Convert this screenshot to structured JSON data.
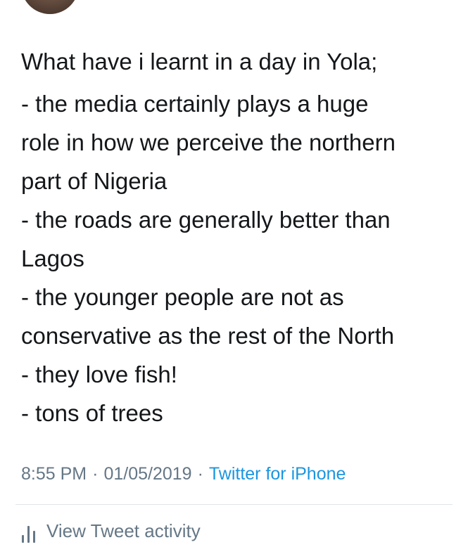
{
  "tweet": {
    "lines": [
      "What have i learnt in a day in Yola;",
      "- the media certainly plays a huge",
      "role in how we perceive the northern",
      "part of Nigeria",
      "- the roads are generally better than",
      "Lagos",
      "- the younger people are not as",
      "conservative as the rest of the North",
      "- they love fish!",
      "- tons of trees"
    ],
    "time": "8:55 PM",
    "date": "01/05/2019",
    "separator": "·",
    "source": "Twitter for iPhone"
  },
  "activity": {
    "label": "View Tweet activity",
    "icon": "bar-chart-icon"
  },
  "colors": {
    "text": "#14171a",
    "muted": "#657786",
    "link": "#1b95e0",
    "divider": "#dfe5ea"
  }
}
